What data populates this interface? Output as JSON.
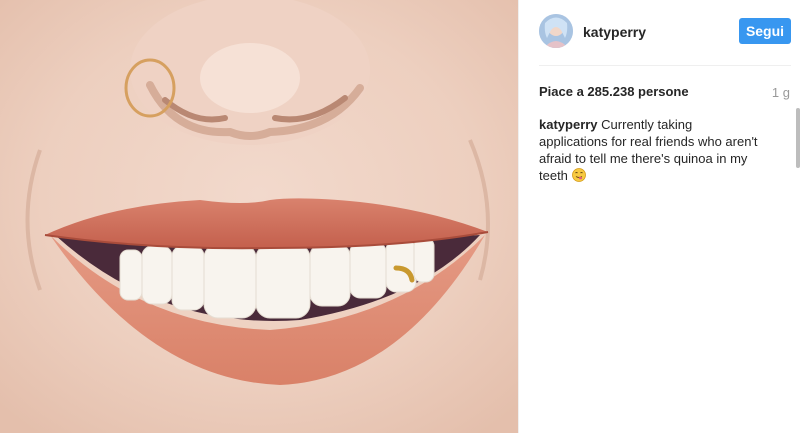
{
  "post": {
    "username": "katyperry",
    "follow_label": "Segui",
    "likes_text": "Piace a 285.238 persone",
    "age_text": "1 g",
    "caption_user": "katyperry",
    "caption_text": "Currently taking applications for real friends who aren't afraid to tell me there's quinoa in my teeth",
    "caption_emoji": "face-with-tongue-icon"
  },
  "colors": {
    "follow_button": "#3897f0",
    "text": "#262626",
    "muted": "#999999",
    "divider": "#efefef"
  }
}
